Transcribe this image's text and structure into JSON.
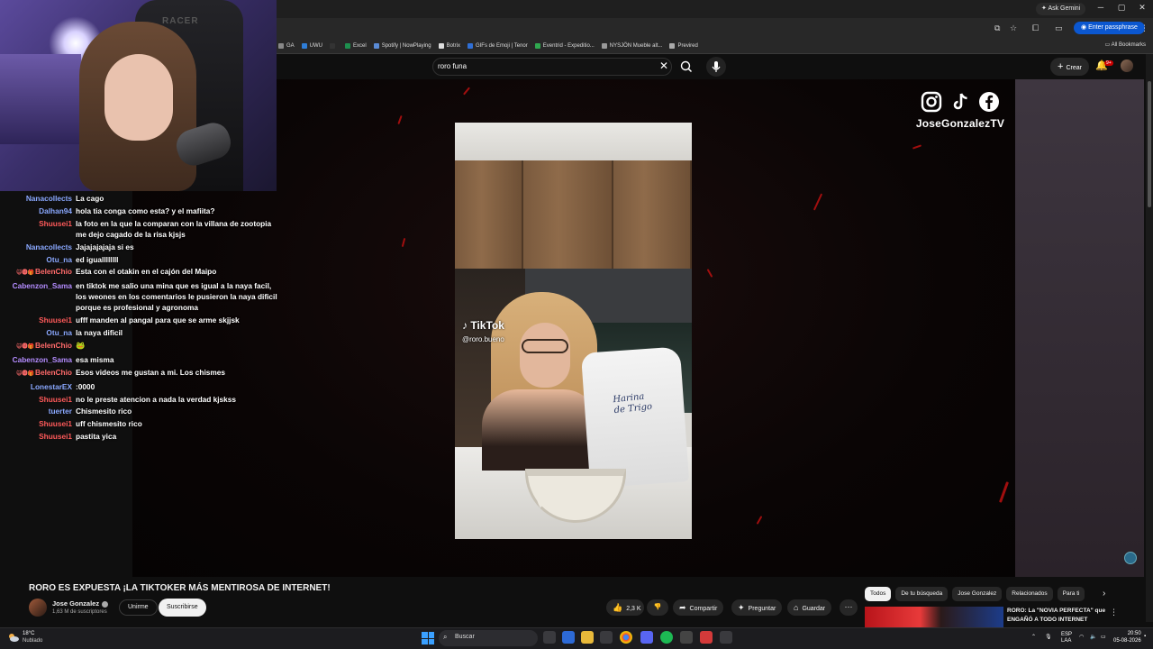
{
  "browser": {
    "gemini_label": "Ask Gemini",
    "passphrase_label": "Enter passphrase",
    "all_bookmarks_label": "All Bookmarks",
    "bookmarks": [
      {
        "label": "GA",
        "color": "#888888"
      },
      {
        "label": "UWU",
        "color": "#2e7dd7"
      },
      {
        "label": "",
        "color": "#333333"
      },
      {
        "label": "Excel",
        "color": "#1d8f4e"
      },
      {
        "label": "Spotify | NowPlaying",
        "color": "#5a8bd6"
      },
      {
        "label": "Botrix",
        "color": "#dddddd"
      },
      {
        "label": "GIFs de Emoji | Tenor",
        "color": "#2f6fd6"
      },
      {
        "label": "Eventrid - Expeditio...",
        "color": "#2fa84f"
      },
      {
        "label": "NYSJÖN Mueble alt...",
        "color": "#999999"
      },
      {
        "label": "Previred",
        "color": "#aaaaaa"
      }
    ]
  },
  "youtube": {
    "search_query": "roro funa",
    "create_label": "Crear",
    "notifications_badge": "9+",
    "video": {
      "social_handle": "JoseGonzalezTV",
      "tiktok_watermark": "TikTok",
      "tiktok_handle": "@roro.bueno",
      "bag_text_line1": "Harina",
      "bag_text_line2": "de Trigo",
      "title": "RORO ES EXPUESTA ¡LA TIKTOKER MÁS MENTIROSA DE INTERNET!"
    },
    "channel": {
      "name": "Jose Gonzalez",
      "subscribers": "1,63 M de suscriptores",
      "join_label": "Unirme",
      "subscribe_label": "Suscribirse"
    },
    "actions": {
      "likes": "2,3 K",
      "share": "Compartir",
      "ask": "Preguntar",
      "save": "Guardar"
    },
    "chips": [
      "Todos",
      "De tu búsqueda",
      "Jose Gonzalez",
      "Relacionados",
      "Para ti"
    ],
    "recommendation": {
      "title": "RORO: La \"NOVIA PERFECTA\" que ENGAÑÓ A TODO INTERNET"
    }
  },
  "chat": [
    {
      "user": "Nanacollects",
      "color": "#8aa8ff",
      "badges": "",
      "text": "La cago"
    },
    {
      "user": "Dalhan94",
      "color": "#8aa8ff",
      "badges": "",
      "text": "hola tia conga como esta? y el mafiita?"
    },
    {
      "user": "Shuusei1",
      "color": "#ff5a5a",
      "badges": "",
      "text": "la foto en la que la comparan con la villana de zootopia me dejo cagado de la risa kjsjs"
    },
    {
      "user": "Nanacollects",
      "color": "#8aa8ff",
      "badges": "",
      "text": "Jajajajajaja si es"
    },
    {
      "user": "Otu_na",
      "color": "#8aa8ff",
      "badges": "",
      "text": "ed iguallllllll"
    },
    {
      "user": "BelenChio",
      "color": "#ff6a6a",
      "badges": "😺🅜🎁",
      "text": "Esta con el otakin en el cajón del Maipo"
    },
    {
      "user": "Cabenzon_Sama",
      "color": "#b48cff",
      "badges": "",
      "text": "en tiktok me salio una mina que es igual a la naya facil, los weones en los comentarios le pusieron la naya dificil porque es profesional y agronoma"
    },
    {
      "user": "Shuusei1",
      "color": "#ff5a5a",
      "badges": "",
      "text": "ufff manden al pangal para que se arme skjjsk"
    },
    {
      "user": "Otu_na",
      "color": "#8aa8ff",
      "badges": "",
      "text": "la naya dificil"
    },
    {
      "user": "BelenChio",
      "color": "#ff6a6a",
      "badges": "😺🅜🎁",
      "text": "🐸"
    },
    {
      "user": "Cabenzon_Sama",
      "color": "#b48cff",
      "badges": "",
      "text": "esa misma"
    },
    {
      "user": "BelenChio",
      "color": "#ff6a6a",
      "badges": "😺🅜🎁",
      "text": "Esos videos me gustan a mi. Los chismes"
    },
    {
      "user": "LonestarEX",
      "color": "#8aa8ff",
      "badges": "",
      "text": ":0000"
    },
    {
      "user": "Shuusei1",
      "color": "#ff5a5a",
      "badges": "",
      "text": "no le preste atencion a nada la verdad kjskss"
    },
    {
      "user": "tuerter",
      "color": "#8aa8ff",
      "badges": "",
      "text": "Chismesito rico"
    },
    {
      "user": "Shuusei1",
      "color": "#ff5a5a",
      "badges": "",
      "text": "uff chismesito rico"
    },
    {
      "user": "Shuusei1",
      "color": "#ff5a5a",
      "badges": "",
      "text": "pastita yica"
    }
  ],
  "taskbar": {
    "weather_temp": "18°C",
    "weather_condition": "Nublado",
    "search_placeholder": "Buscar",
    "lang_line1": "ESP",
    "lang_line2": "LAA",
    "time": "20:50",
    "date": "05-08-2026"
  }
}
